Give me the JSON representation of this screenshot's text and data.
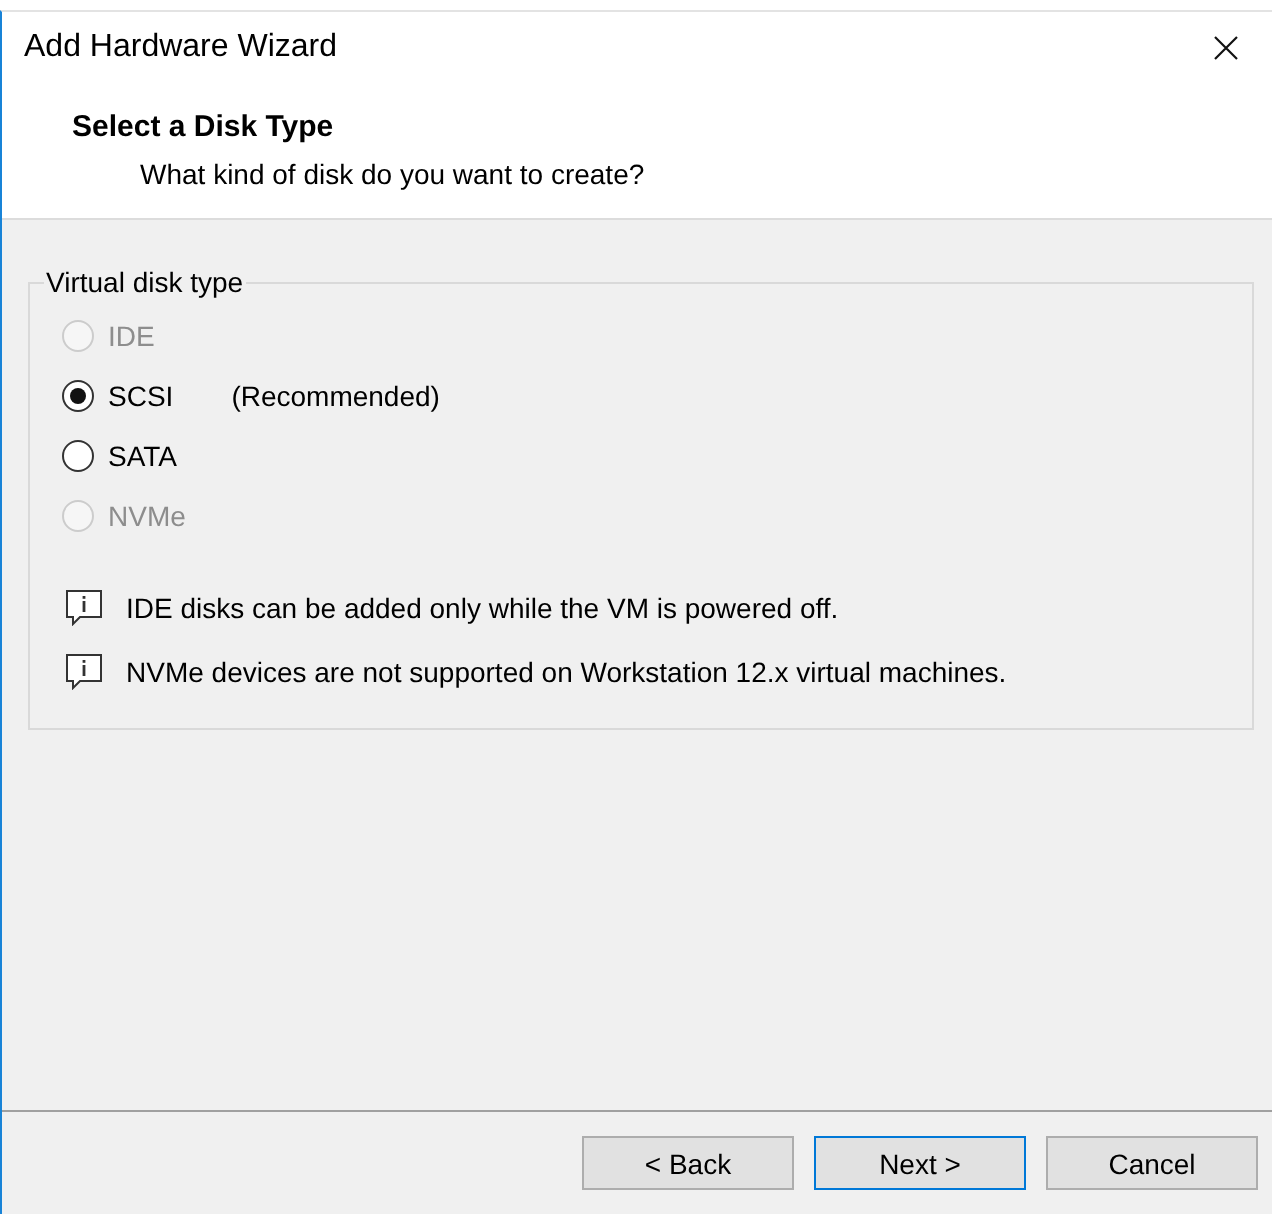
{
  "window": {
    "title": "Add Hardware Wizard"
  },
  "header": {
    "title": "Select a Disk Type",
    "subtitle": "What kind of disk do you want to create?"
  },
  "disk_type": {
    "label": "Virtual disk type",
    "options": [
      {
        "label": "IDE",
        "selected": false,
        "disabled": true
      },
      {
        "label": "SCSI",
        "note": "(Recommended)",
        "selected": true,
        "disabled": false
      },
      {
        "label": "SATA",
        "selected": false,
        "disabled": false
      },
      {
        "label": "NVMe",
        "selected": false,
        "disabled": true
      }
    ],
    "notes": [
      "IDE disks can be added only while the VM is powered off.",
      "NVMe devices are not supported on Workstation 12.x virtual machines."
    ]
  },
  "buttons": [
    {
      "label": "< Back",
      "focused": false
    },
    {
      "label": "Next >",
      "focused": true
    },
    {
      "label": "Cancel",
      "focused": false
    }
  ]
}
